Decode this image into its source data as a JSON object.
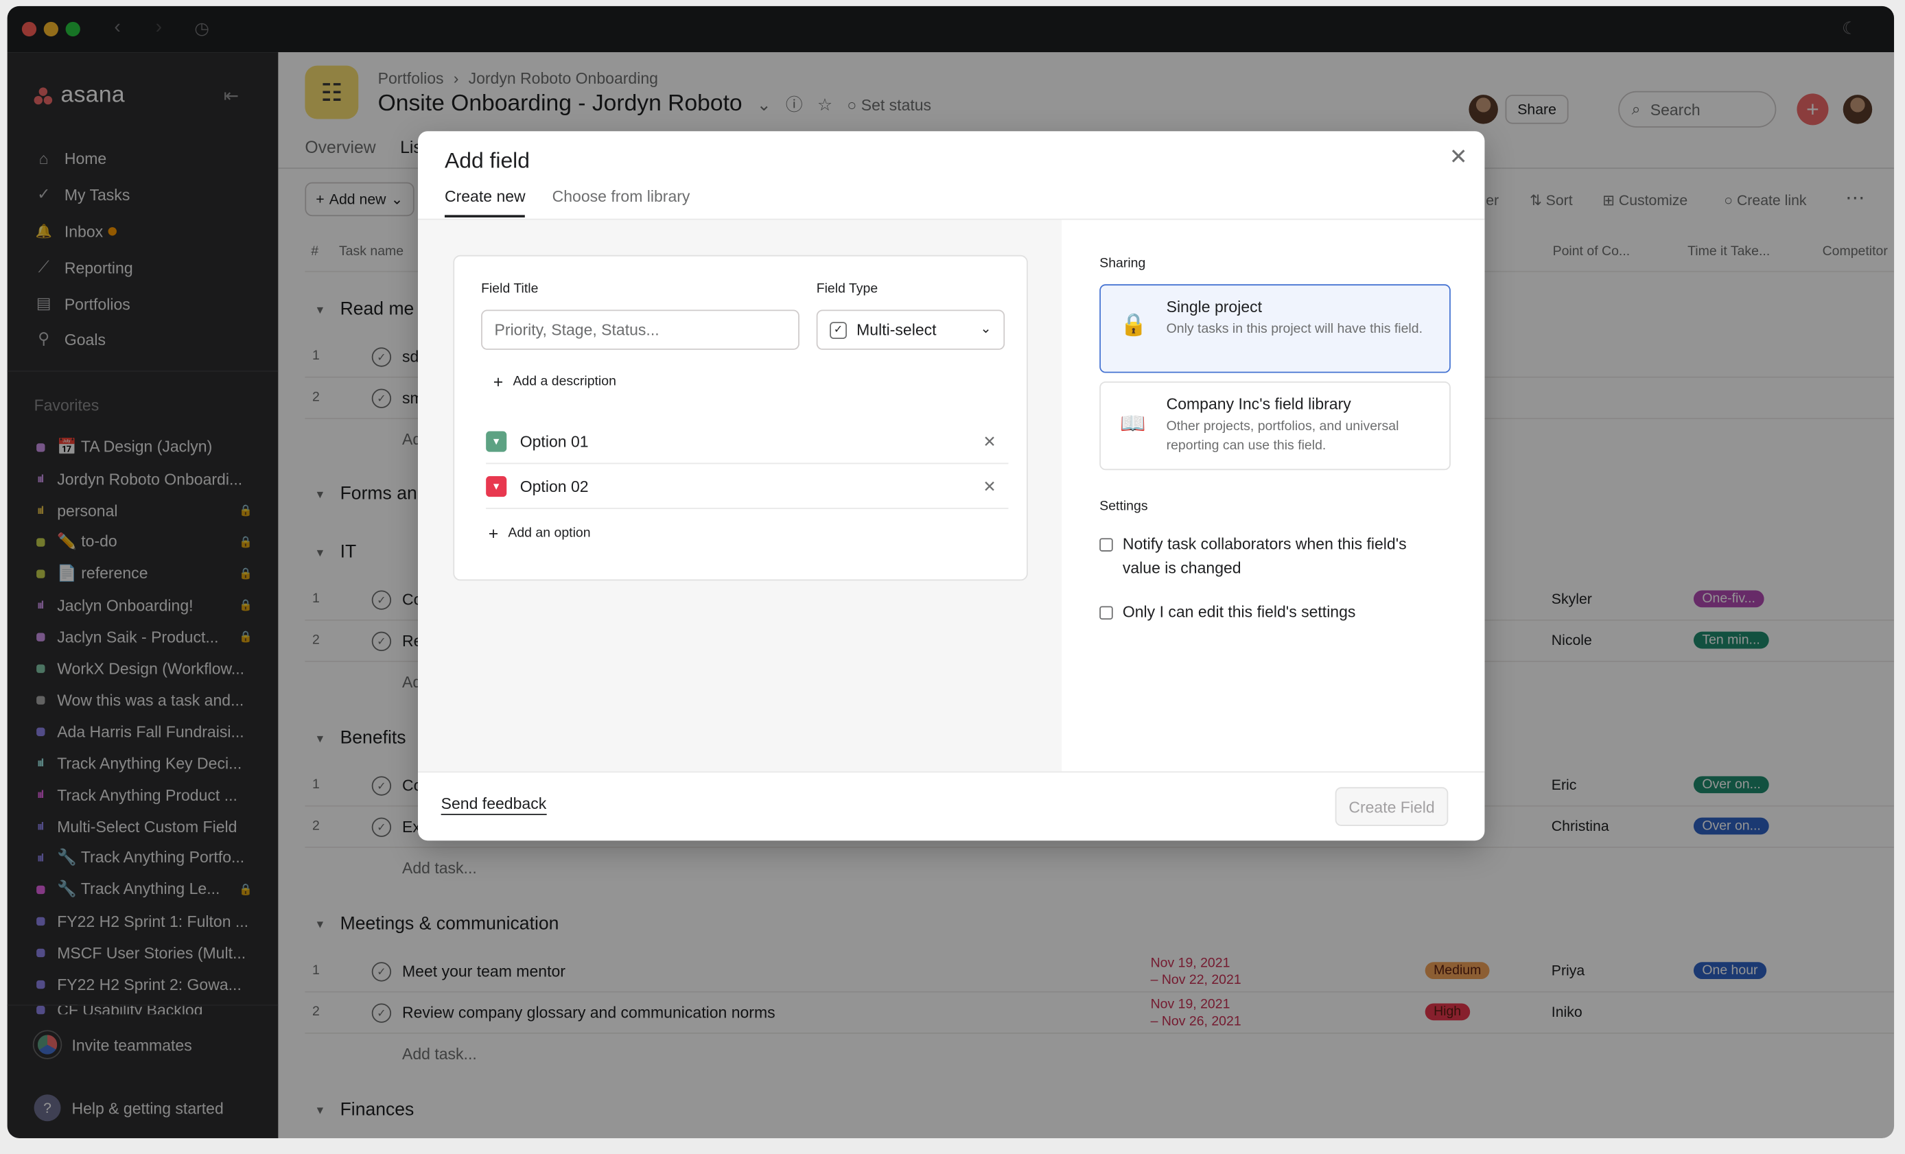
{
  "sidebar": {
    "logo": "asana",
    "nav": [
      {
        "label": "Home",
        "icon": "home-icon"
      },
      {
        "label": "My Tasks",
        "icon": "check-circle-icon"
      },
      {
        "label": "Inbox",
        "icon": "bell-icon"
      },
      {
        "label": "Reporting",
        "icon": "chart-line-icon"
      },
      {
        "label": "Portfolios",
        "icon": "folder-icon"
      },
      {
        "label": "Goals",
        "icon": "person-icon"
      }
    ],
    "favorites_title": "Favorites",
    "favorites": [
      {
        "label": "📅 TA Design (Jaclyn)",
        "mark": "square",
        "color": "#cd95ea",
        "locked": false
      },
      {
        "label": "Jordyn Roboto Onboardi...",
        "mark": "bars",
        "color": "#cd95ea",
        "locked": false
      },
      {
        "label": "personal",
        "mark": "bars",
        "color": "#e8c34a",
        "locked": true
      },
      {
        "label": "✏️ to-do",
        "mark": "square",
        "color": "#c7d34f",
        "locked": true
      },
      {
        "label": "📄 reference",
        "mark": "square",
        "color": "#c7d34f",
        "locked": true
      },
      {
        "label": "Jaclyn Onboarding!",
        "mark": "bars",
        "color": "#cd95ea",
        "locked": true
      },
      {
        "label": "Jaclyn Saik - Product...",
        "mark": "square",
        "color": "#cd95ea",
        "locked": true
      },
      {
        "label": "WorkX Design (Workflow...",
        "mark": "square",
        "color": "#83c9a9",
        "locked": false
      },
      {
        "label": "Wow this was a task and...",
        "mark": "square",
        "color": "#aaa",
        "locked": false
      },
      {
        "label": "Ada Harris Fall Fundraisi...",
        "mark": "square",
        "color": "#8d84e8",
        "locked": false
      },
      {
        "label": "Track Anything Key Deci...",
        "mark": "bars",
        "color": "#9ee7e3",
        "locked": false
      },
      {
        "label": "Track Anything Product ...",
        "mark": "bars",
        "color": "#e362e3",
        "locked": false
      },
      {
        "label": "Multi-Select Custom Field",
        "mark": "bars",
        "color": "#8d84e8",
        "locked": false
      },
      {
        "label": "🔧 Track Anything Portfo...",
        "mark": "bars",
        "color": "#8d84e8",
        "locked": false
      },
      {
        "label": "🔧 Track Anything Le...",
        "mark": "square",
        "color": "#e362e3",
        "locked": true
      },
      {
        "label": "FY22 H2 Sprint 1: Fulton ...",
        "mark": "square",
        "color": "#8d84e8",
        "locked": false
      },
      {
        "label": "MSCF User Stories (Mult...",
        "mark": "square",
        "color": "#8d84e8",
        "locked": false
      },
      {
        "label": "FY22 H2 Sprint 2: Gowa...",
        "mark": "square",
        "color": "#8d84e8",
        "locked": false
      },
      {
        "label": "CF Usability Backlog",
        "mark": "square",
        "color": "#8d84e8",
        "locked": false
      }
    ],
    "invite": "Invite teammates",
    "help": "Help & getting started"
  },
  "header": {
    "breadcrumb": [
      "Portfolios",
      "Jordyn Roboto Onboarding"
    ],
    "title": "Onsite Onboarding - Jordyn Roboto",
    "set_status": "Set status",
    "share": "Share",
    "search_placeholder": "Search",
    "tabs": [
      "Overview",
      "List"
    ]
  },
  "toolbar": {
    "add_new": "Add new",
    "items": [
      "er",
      "Sort",
      "Customize",
      "Create link"
    ]
  },
  "table": {
    "col_num": "#",
    "col_task": "Task name",
    "col_headers": [
      "Point of Co...",
      "Time it Take...",
      "Competitor"
    ],
    "sections": [
      {
        "title": "Read me",
        "rows": [
          {
            "num": "1",
            "name": "sd"
          },
          {
            "num": "2",
            "name": "sm"
          }
        ],
        "add": "Add task..."
      },
      {
        "title": "Forms an",
        "rows": [],
        "add": ""
      },
      {
        "title": "IT",
        "rows": [
          {
            "num": "1",
            "name": "Co",
            "person": "Skyler",
            "pill": "One-fiv..."
          },
          {
            "num": "2",
            "name": "Re",
            "person": "Nicole",
            "pill": "Ten min..."
          }
        ],
        "add": "Add task..."
      },
      {
        "title": "Benefits",
        "rows": [
          {
            "num": "1",
            "name": "Co",
            "person": "Eric",
            "pill": "Over on..."
          },
          {
            "num": "2",
            "name": "Ex",
            "person": "Christina",
            "pill": "Over on..."
          }
        ],
        "add": "Add task..."
      },
      {
        "title": "Meetings & communication",
        "rows": [
          {
            "num": "1",
            "name": "Meet your team mentor",
            "date1": "Nov 19, 2021",
            "date2": "– Nov 22, 2021",
            "priority": "Medium",
            "person": "Priya",
            "pill": "One hour"
          },
          {
            "num": "2",
            "name": "Review company glossary and communication norms",
            "date1": "Nov 19, 2021",
            "date2": "– Nov 26, 2021",
            "priority": "High",
            "person": "Iniko",
            "pill": ""
          }
        ],
        "add": "Add task..."
      },
      {
        "title": "Finances",
        "rows": [],
        "add": ""
      }
    ]
  },
  "modal": {
    "title": "Add field",
    "tabs": [
      "Create new",
      "Choose from library"
    ],
    "field_title_label": "Field Title",
    "field_title_placeholder": "Priority, Stage, Status...",
    "field_type_label": "Field Type",
    "field_type_value": "Multi-select",
    "add_description": "Add a description",
    "options": [
      {
        "label": "Option 01",
        "color": "#5da283",
        "glyph": "⌄"
      },
      {
        "label": "Option 02",
        "color": "#e8384f",
        "glyph": "⌄"
      }
    ],
    "add_option": "Add an option",
    "sharing_label": "Sharing",
    "sharing": [
      {
        "title": "Single project",
        "desc": "Only tasks in this project will have this field.",
        "selected": true
      },
      {
        "title": "Company Inc's field library",
        "desc": "Other projects, portfolios, and universal reporting can use this field.",
        "selected": false
      }
    ],
    "settings_label": "Settings",
    "settings": [
      "Notify task collaborators when this field's value is changed",
      "Only I can edit this field's settings"
    ],
    "send_feedback": "Send feedback",
    "create_button": "Create Field"
  }
}
